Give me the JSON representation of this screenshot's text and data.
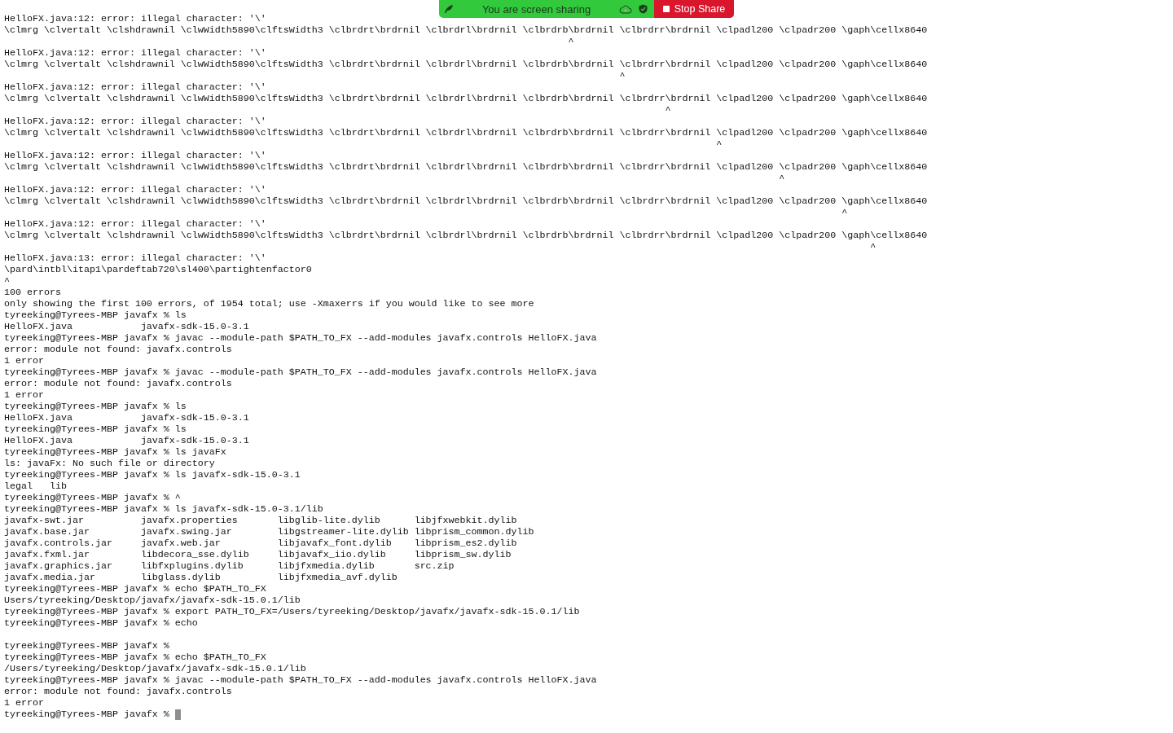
{
  "banner": {
    "message": "You are screen sharing",
    "stop_button": "Stop Share"
  },
  "terminal": {
    "lines": [
      {
        "kind": "text",
        "text": "HelloFX.java:12: error: illegal character: '\\'"
      },
      {
        "kind": "text",
        "text": "\\clmrg \\clvertalt \\clshdrawnil \\clwWidth5890\\clftsWidth3 \\clbrdrt\\brdrnil \\clbrdrl\\brdrnil \\clbrdrb\\brdrnil \\clbrdrr\\brdrnil \\clpadl200 \\clpadr200 \\gaph\\cellx8640"
      },
      {
        "kind": "text",
        "text": "                                                                                                   ^"
      },
      {
        "kind": "text",
        "text": "HelloFX.java:12: error: illegal character: '\\'"
      },
      {
        "kind": "text",
        "text": "\\clmrg \\clvertalt \\clshdrawnil \\clwWidth5890\\clftsWidth3 \\clbrdrt\\brdrnil \\clbrdrl\\brdrnil \\clbrdrb\\brdrnil \\clbrdrr\\brdrnil \\clpadl200 \\clpadr200 \\gaph\\cellx8640"
      },
      {
        "kind": "text",
        "text": "                                                                                                            ^"
      },
      {
        "kind": "text",
        "text": "HelloFX.java:12: error: illegal character: '\\'"
      },
      {
        "kind": "text",
        "text": "\\clmrg \\clvertalt \\clshdrawnil \\clwWidth5890\\clftsWidth3 \\clbrdrt\\brdrnil \\clbrdrl\\brdrnil \\clbrdrb\\brdrnil \\clbrdrr\\brdrnil \\clpadl200 \\clpadr200 \\gaph\\cellx8640"
      },
      {
        "kind": "text",
        "text": "                                                                                                                    ^"
      },
      {
        "kind": "text",
        "text": "HelloFX.java:12: error: illegal character: '\\'"
      },
      {
        "kind": "text",
        "text": "\\clmrg \\clvertalt \\clshdrawnil \\clwWidth5890\\clftsWidth3 \\clbrdrt\\brdrnil \\clbrdrl\\brdrnil \\clbrdrb\\brdrnil \\clbrdrr\\brdrnil \\clpadl200 \\clpadr200 \\gaph\\cellx8640"
      },
      {
        "kind": "text",
        "text": "                                                                                                                             ^"
      },
      {
        "kind": "text",
        "text": "HelloFX.java:12: error: illegal character: '\\'"
      },
      {
        "kind": "text",
        "text": "\\clmrg \\clvertalt \\clshdrawnil \\clwWidth5890\\clftsWidth3 \\clbrdrt\\brdrnil \\clbrdrl\\brdrnil \\clbrdrb\\brdrnil \\clbrdrr\\brdrnil \\clpadl200 \\clpadr200 \\gaph\\cellx8640"
      },
      {
        "kind": "text",
        "text": "                                                                                                                                        ^"
      },
      {
        "kind": "text",
        "text": "HelloFX.java:12: error: illegal character: '\\'"
      },
      {
        "kind": "text",
        "text": "\\clmrg \\clvertalt \\clshdrawnil \\clwWidth5890\\clftsWidth3 \\clbrdrt\\brdrnil \\clbrdrl\\brdrnil \\clbrdrb\\brdrnil \\clbrdrr\\brdrnil \\clpadl200 \\clpadr200 \\gaph\\cellx8640"
      },
      {
        "kind": "text",
        "text": "                                                                                                                                                   ^"
      },
      {
        "kind": "text",
        "text": "HelloFX.java:12: error: illegal character: '\\'"
      },
      {
        "kind": "text",
        "text": "\\clmrg \\clvertalt \\clshdrawnil \\clwWidth5890\\clftsWidth3 \\clbrdrt\\brdrnil \\clbrdrl\\brdrnil \\clbrdrb\\brdrnil \\clbrdrr\\brdrnil \\clpadl200 \\clpadr200 \\gaph\\cellx8640"
      },
      {
        "kind": "text",
        "text": "                                                                                                                                                        ^"
      },
      {
        "kind": "text",
        "text": "HelloFX.java:13: error: illegal character: '\\'"
      },
      {
        "kind": "text",
        "text": "\\pard\\intbl\\itap1\\pardeftab720\\sl400\\partightenfactor0"
      },
      {
        "kind": "text",
        "text": "^"
      },
      {
        "kind": "text",
        "text": "100 errors"
      },
      {
        "kind": "text",
        "text": "only showing the first 100 errors, of 1954 total; use -Xmaxerrs if you would like to see more"
      },
      {
        "kind": "text",
        "text": "tyreeking@Tyrees-MBP javafx % ls"
      },
      {
        "kind": "text",
        "text": "HelloFX.java            javafx-sdk-15.0-3.1"
      },
      {
        "kind": "text",
        "text": "tyreeking@Tyrees-MBP javafx % javac --module-path $PATH_TO_FX --add-modules javafx.controls HelloFX.java"
      },
      {
        "kind": "text",
        "text": "error: module not found: javafx.controls"
      },
      {
        "kind": "text",
        "text": "1 error"
      },
      {
        "kind": "text",
        "text": "tyreeking@Tyrees-MBP javafx % javac --module-path $PATH_TO_FX --add-modules javafx.controls HelloFX.java"
      },
      {
        "kind": "text",
        "text": "error: module not found: javafx.controls"
      },
      {
        "kind": "text",
        "text": "1 error"
      },
      {
        "kind": "text",
        "text": "tyreeking@Tyrees-MBP javafx % ls"
      },
      {
        "kind": "text",
        "text": "HelloFX.java            javafx-sdk-15.0-3.1"
      },
      {
        "kind": "text",
        "text": "tyreeking@Tyrees-MBP javafx % ls"
      },
      {
        "kind": "text",
        "text": "HelloFX.java            javafx-sdk-15.0-3.1"
      },
      {
        "kind": "text",
        "text": "tyreeking@Tyrees-MBP javafx % ls javaFx"
      },
      {
        "kind": "text",
        "text": "ls: javaFx: No such file or directory"
      },
      {
        "kind": "text",
        "text": "tyreeking@Tyrees-MBP javafx % ls javafx-sdk-15.0-3.1"
      },
      {
        "kind": "text",
        "text": "legal   lib"
      },
      {
        "kind": "text",
        "text": "tyreeking@Tyrees-MBP javafx % ^"
      },
      {
        "kind": "text",
        "text": "tyreeking@Tyrees-MBP javafx % ls javafx-sdk-15.0-3.1/lib"
      },
      {
        "kind": "text",
        "text": "javafx-swt.jar          javafx.properties       libglib-lite.dylib      libjfxwebkit.dylib"
      },
      {
        "kind": "text",
        "text": "javafx.base.jar         javafx.swing.jar        libgstreamer-lite.dylib libprism_common.dylib"
      },
      {
        "kind": "text",
        "text": "javafx.controls.jar     javafx.web.jar          libjavafx_font.dylib    libprism_es2.dylib"
      },
      {
        "kind": "text",
        "text": "javafx.fxml.jar         libdecora_sse.dylib     libjavafx_iio.dylib     libprism_sw.dylib"
      },
      {
        "kind": "text",
        "text": "javafx.graphics.jar     libfxplugins.dylib      libjfxmedia.dylib       src.zip"
      },
      {
        "kind": "text",
        "text": "javafx.media.jar        libglass.dylib          libjfxmedia_avf.dylib"
      },
      {
        "kind": "text",
        "text": "tyreeking@Tyrees-MBP javafx % echo $PATH_TO_FX"
      },
      {
        "kind": "text",
        "text": "Users/tyreeking/Desktop/javafx/javafx-sdk-15.0.1/lib"
      },
      {
        "kind": "text",
        "text": "tyreeking@Tyrees-MBP javafx % export PATH_TO_FX=/Users/tyreeking/Desktop/javafx/javafx-sdk-15.0.1/lib"
      },
      {
        "kind": "text",
        "text": "tyreeking@Tyrees-MBP javafx % echo"
      },
      {
        "kind": "blank"
      },
      {
        "kind": "text",
        "text": "tyreeking@Tyrees-MBP javafx %"
      },
      {
        "kind": "text",
        "text": "tyreeking@Tyrees-MBP javafx % echo $PATH_TO_FX"
      },
      {
        "kind": "text",
        "text": "/Users/tyreeking/Desktop/javafx/javafx-sdk-15.0.1/lib"
      },
      {
        "kind": "text",
        "text": "tyreeking@Tyrees-MBP javafx % javac --module-path $PATH_TO_FX --add-modules javafx.controls HelloFX.java"
      },
      {
        "kind": "text",
        "text": "error: module not found: javafx.controls"
      },
      {
        "kind": "text",
        "text": "1 error"
      },
      {
        "kind": "cursor",
        "text": "tyreeking@Tyrees-MBP javafx % "
      }
    ]
  }
}
